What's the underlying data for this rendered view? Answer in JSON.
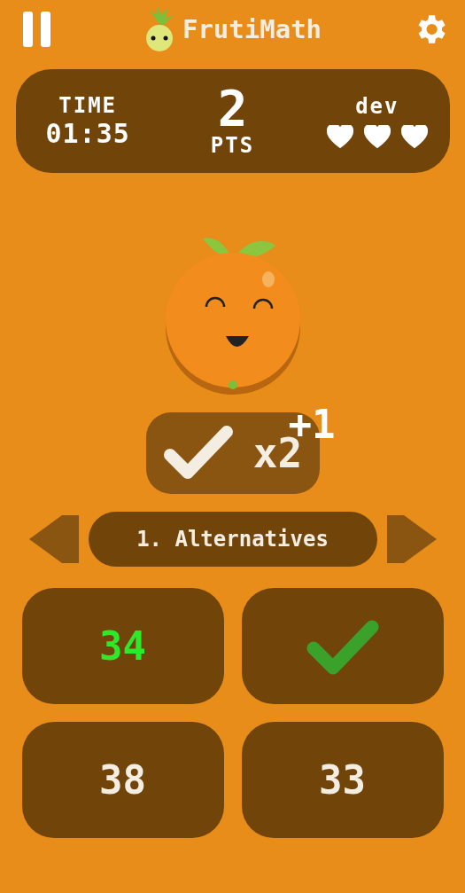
{
  "header": {
    "title": "FrutiMath"
  },
  "stats": {
    "time_label": "TIME",
    "time": "01:35",
    "points": "2",
    "points_label": "PTS",
    "player": "dev",
    "hearts": [
      {
        "filled": true
      },
      {
        "filled": true
      },
      {
        "filled": true
      }
    ]
  },
  "feedback": {
    "kind": "correct",
    "multiplier": "x2",
    "bonus": "+1"
  },
  "mode": {
    "label": "1. Alternatives"
  },
  "answers": [
    {
      "kind": "number",
      "text": "34",
      "correct": true
    },
    {
      "kind": "check"
    },
    {
      "kind": "number",
      "text": "38",
      "correct": false
    },
    {
      "kind": "number",
      "text": "33",
      "correct": false
    }
  ]
}
